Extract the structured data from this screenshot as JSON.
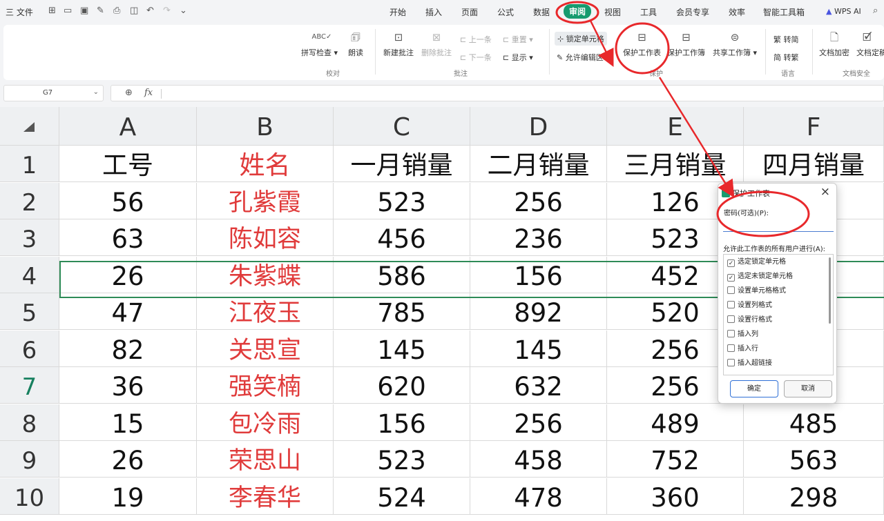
{
  "app": {
    "menu_label": "三 文件",
    "wps_ai": "WPS AI"
  },
  "tabs": [
    "开始",
    "插入",
    "页面",
    "公式",
    "数据",
    "审阅",
    "视图",
    "工具",
    "会员专享",
    "效率",
    "智能工具箱"
  ],
  "ribbon": {
    "spell_check": "拼写检查",
    "read_aloud": "朗读",
    "group_proof": "校对",
    "new_comment": "新建批注",
    "delete_comment": "删除批注",
    "prev": "上一条",
    "next": "下一条",
    "reset": "重置",
    "show": "显示",
    "group_comment": "批注",
    "lock_cells": "锁定单元格",
    "allow_edit": "允许编辑区域",
    "protect_sheet": "保护工作表",
    "protect_book": "保护工作簿",
    "share_book": "共享工作簿",
    "group_protect": "保护",
    "to_simplified": "繁 转简",
    "to_traditional": "简 转繁",
    "group_lang": "语言",
    "doc_encrypt": "文档加密",
    "doc_finalize": "文档定稿",
    "group_security": "文档安全"
  },
  "formula_bar": {
    "cell_ref": "G7",
    "fx": "fx"
  },
  "sheet": {
    "columns": [
      "A",
      "B",
      "C",
      "D",
      "E",
      "F"
    ],
    "rows": [
      [
        "1",
        "工号",
        "姓名",
        "一月销量",
        "二月销量",
        "三月销量",
        "四月销量"
      ],
      [
        "2",
        "56",
        "孔紫霞",
        "523",
        "256",
        "126",
        ""
      ],
      [
        "3",
        "63",
        "陈如容",
        "456",
        "236",
        "523",
        ""
      ],
      [
        "4",
        "26",
        "朱紫蝶",
        "586",
        "156",
        "452",
        ""
      ],
      [
        "5",
        "47",
        "江夜玉",
        "785",
        "892",
        "520",
        ""
      ],
      [
        "6",
        "82",
        "关思宣",
        "145",
        "145",
        "256",
        ""
      ],
      [
        "7",
        "36",
        "强笑楠",
        "620",
        "632",
        "256",
        ""
      ],
      [
        "8",
        "15",
        "包冷雨",
        "156",
        "256",
        "489",
        "485"
      ],
      [
        "9",
        "26",
        "荣思山",
        "523",
        "458",
        "752",
        "563"
      ],
      [
        "10",
        "19",
        "李春华",
        "524",
        "478",
        "360",
        "298"
      ]
    ]
  },
  "dialog": {
    "title": "保护工作表",
    "password_label": "密码(可选)(P):",
    "password_value": "",
    "allow_label": "允许此工作表的所有用户进行(A):",
    "options": [
      {
        "label": "选定锁定单元格",
        "checked": true
      },
      {
        "label": "选定未锁定单元格",
        "checked": true
      },
      {
        "label": "设置单元格格式",
        "checked": false
      },
      {
        "label": "设置列格式",
        "checked": false
      },
      {
        "label": "设置行格式",
        "checked": false
      },
      {
        "label": "插入列",
        "checked": false
      },
      {
        "label": "插入行",
        "checked": false
      },
      {
        "label": "插入超链接",
        "checked": false
      }
    ],
    "ok": "确定",
    "cancel": "取消"
  },
  "colors": {
    "accent": "#179b6f",
    "name_red": "#e03b3b",
    "annotation_red": "#e8282b",
    "selection": "#2e8b57"
  }
}
